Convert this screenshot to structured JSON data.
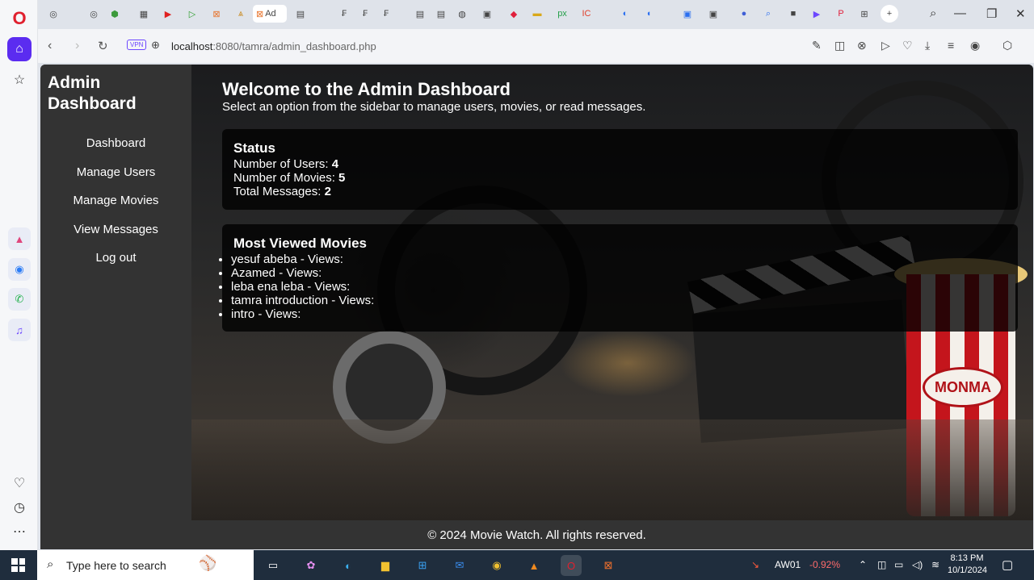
{
  "browser": {
    "active_tab_label": "Ad",
    "address": {
      "host": "localhost",
      "rest": ":8080/tamra/admin_dashboard.php"
    },
    "vpn_label": "VPN"
  },
  "sidebar": {
    "title": "Admin Dashboard",
    "items": [
      {
        "label": "Dashboard"
      },
      {
        "label": "Manage Users"
      },
      {
        "label": "Manage Movies"
      },
      {
        "label": "View Messages"
      },
      {
        "label": "Log out"
      }
    ]
  },
  "main": {
    "heading": "Welcome to the Admin Dashboard",
    "subheading": "Select an option from the sidebar to manage users, movies, or read messages.",
    "status": {
      "title": "Status",
      "users_label": "Number of Users:",
      "users_value": "4",
      "movies_label": "Number of Movies:",
      "movies_value": "5",
      "messages_label": "Total Messages:",
      "messages_value": "2"
    },
    "most_viewed": {
      "title": "Most Viewed Movies",
      "items": [
        "yesuf abeba - Views:",
        "Azamed - Views:",
        "leba ena leba - Views:",
        "tamra introduction - Views:",
        "intro - Views:"
      ]
    },
    "background_brand": "MONMA"
  },
  "footer": {
    "text": "© 2024 Movie Watch. All rights reserved."
  },
  "taskbar": {
    "search_placeholder": "Type here to search",
    "stock_name": "AW01",
    "stock_change": "-0.92%",
    "time": "8:13 PM",
    "date": "10/1/2024"
  }
}
